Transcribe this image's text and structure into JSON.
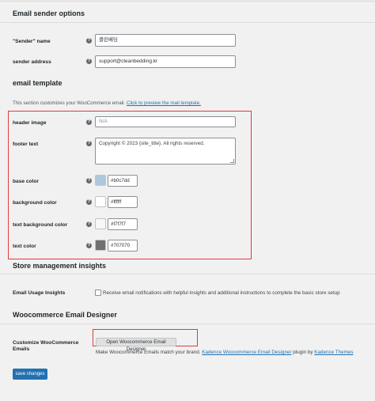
{
  "sender_section": {
    "title": "Email sender options",
    "sender_name_label": "\"Sender\" name",
    "sender_name_value": "클린베딩",
    "sender_address_label": "sender address",
    "sender_address_value": "support@cleanbedding.kr"
  },
  "template_section": {
    "title": "email template",
    "description": "This section customizes your WooCommerce email.",
    "preview_link": "Click to preview the mail template.",
    "header_image_label": "header image",
    "header_image_placeholder": "N/A",
    "footer_text_label": "footer text",
    "footer_text_value": "Copyright © 2023 {site_title}. All rights reserved.",
    "base_color_label": "base color",
    "base_color_value": "#b0c7dd",
    "background_color_label": "background color",
    "background_color_value": "#ffffff",
    "text_background_color_label": "text background color",
    "text_background_color_value": "#f7f7f7",
    "text_color_label": "text color",
    "text_color_value": "#707070"
  },
  "insights_section": {
    "title": "Store management insights",
    "usage_label": "Email Usage Insights",
    "usage_checkbox_text": "Receive email notifications with helpful insights and additional instructions to complete the basic store setup"
  },
  "designer_section": {
    "title": "Woocommerce Email Designer",
    "customize_label_line1": "Customize WooCommerce",
    "customize_label_line2": "Emails",
    "open_button": "Open Woocommerce Email Designer",
    "note_prefix": "Make Woocommerce Emails match your brand.",
    "note_link1": "Kadence Woocommerce Email Designer",
    "note_mid": "plugin by",
    "note_link2": "Kadence Themes"
  },
  "save_button": "save changes",
  "colors": {
    "accent": "#2271b1",
    "highlight_box": "#e03a3a",
    "base": "#b0c7dd",
    "background": "#ffffff",
    "text_background": "#f7f7f7",
    "text": "#707070"
  }
}
